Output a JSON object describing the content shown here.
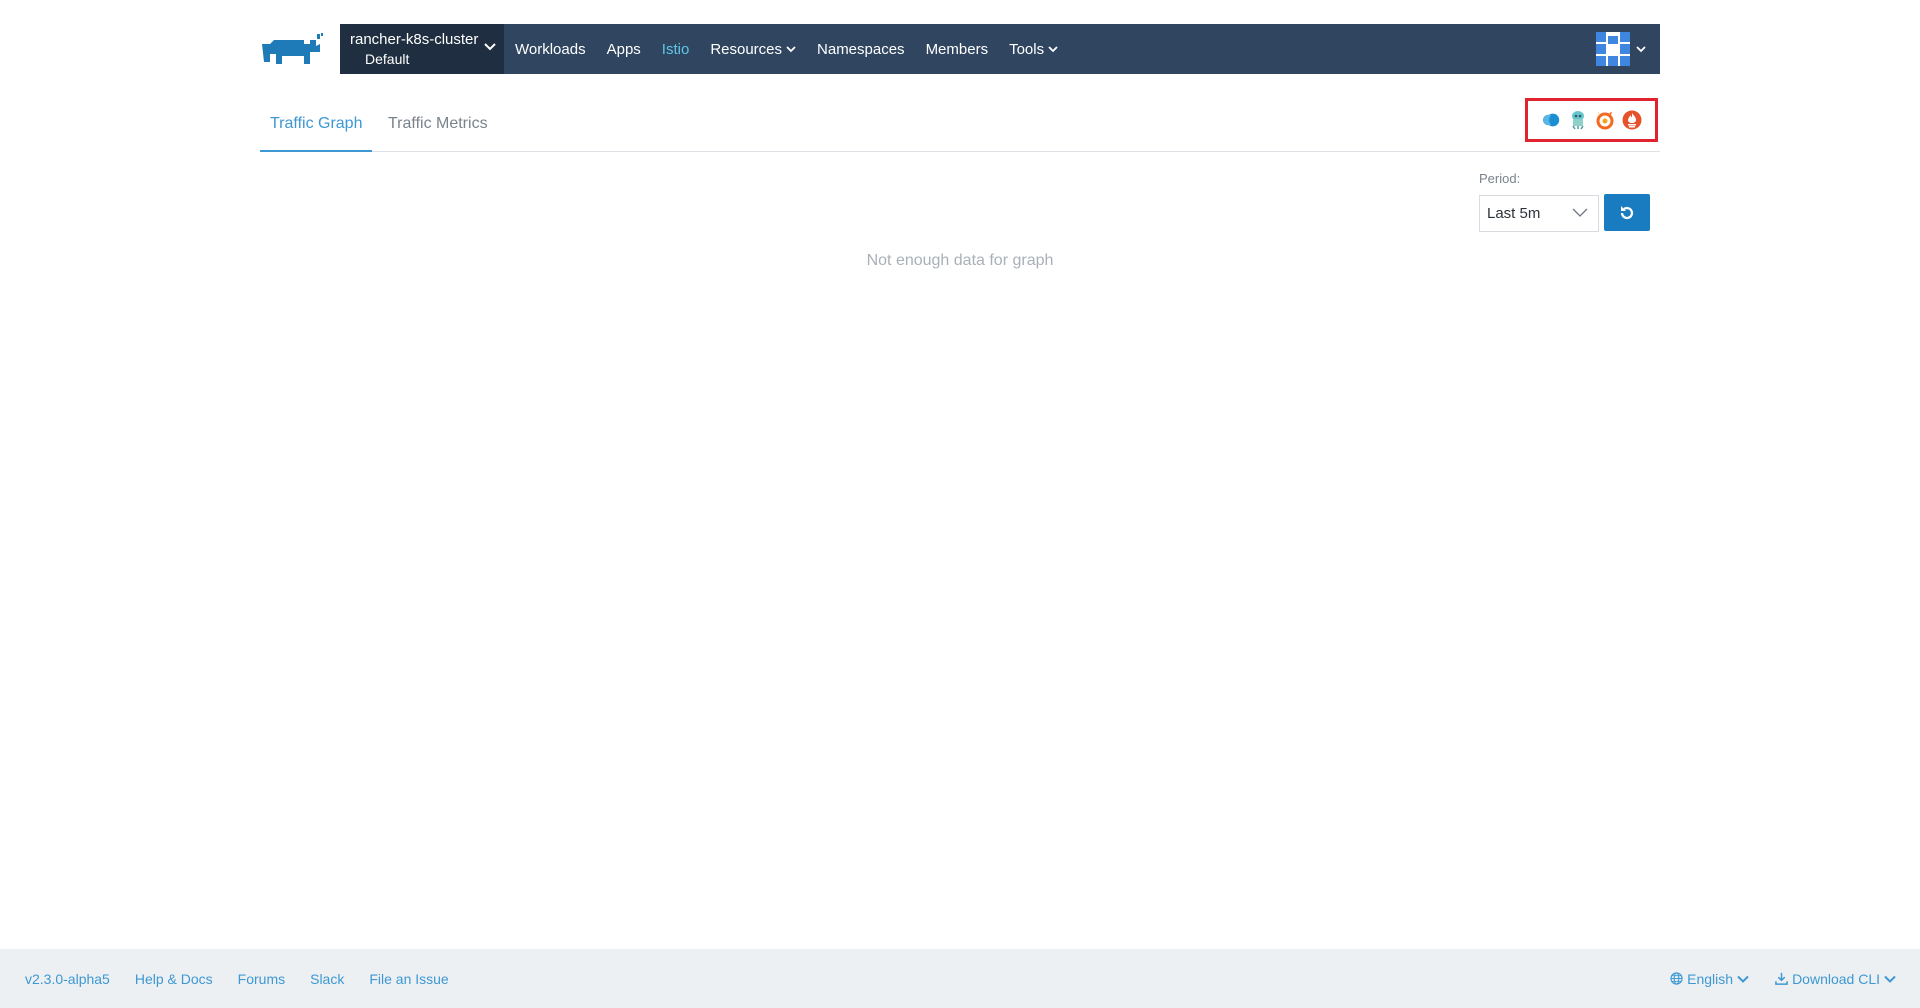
{
  "header": {
    "cluster_name": "rancher-k8s-cluster",
    "project_name": "Default",
    "nav": [
      {
        "label": "Workloads",
        "dropdown": false,
        "active": false
      },
      {
        "label": "Apps",
        "dropdown": false,
        "active": false
      },
      {
        "label": "Istio",
        "dropdown": false,
        "active": true
      },
      {
        "label": "Resources",
        "dropdown": true,
        "active": false
      },
      {
        "label": "Namespaces",
        "dropdown": false,
        "active": false
      },
      {
        "label": "Members",
        "dropdown": false,
        "active": false
      },
      {
        "label": "Tools",
        "dropdown": true,
        "active": false
      }
    ]
  },
  "tabs": {
    "traffic_graph": "Traffic Graph",
    "traffic_metrics": "Traffic Metrics"
  },
  "tool_icons": [
    "kiali-icon",
    "jaeger-icon",
    "grafana-icon",
    "prometheus-icon"
  ],
  "period": {
    "label": "Period:",
    "value": "Last 5m"
  },
  "graph": {
    "empty_message": "Not enough data for graph"
  },
  "footer": {
    "version": "v2.3.0-alpha5",
    "help": "Help & Docs",
    "forums": "Forums",
    "slack": "Slack",
    "issue": "File an Issue",
    "language": "English",
    "download": "Download CLI"
  },
  "colors": {
    "navbar": "#2f4560",
    "accent": "#3d98d3",
    "active_nav": "#5ec7e6",
    "highlight_box": "#e0232f"
  }
}
